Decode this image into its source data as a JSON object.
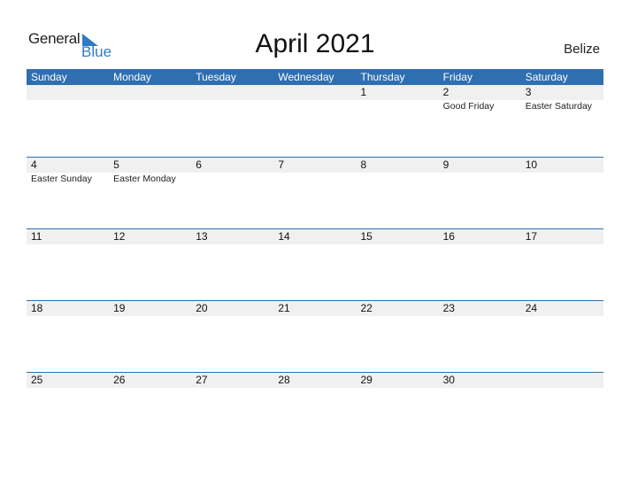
{
  "logo": {
    "word1": "General",
    "word2": "Blue"
  },
  "title": "April 2021",
  "country": "Belize",
  "colors": {
    "header_bg": "#2e6fb0",
    "band_bg": "#f0f0f0",
    "logo_blue": "#2f7bc4"
  },
  "weekdays": [
    "Sunday",
    "Monday",
    "Tuesday",
    "Wednesday",
    "Thursday",
    "Friday",
    "Saturday"
  ],
  "weeks": [
    {
      "days": [
        "",
        "",
        "",
        "",
        "1",
        "2",
        "3"
      ],
      "events": [
        "",
        "",
        "",
        "",
        "",
        "Good Friday",
        "Easter Saturday"
      ]
    },
    {
      "days": [
        "4",
        "5",
        "6",
        "7",
        "8",
        "9",
        "10"
      ],
      "events": [
        "Easter Sunday",
        "Easter Monday",
        "",
        "",
        "",
        "",
        ""
      ]
    },
    {
      "days": [
        "11",
        "12",
        "13",
        "14",
        "15",
        "16",
        "17"
      ],
      "events": [
        "",
        "",
        "",
        "",
        "",
        "",
        ""
      ]
    },
    {
      "days": [
        "18",
        "19",
        "20",
        "21",
        "22",
        "23",
        "24"
      ],
      "events": [
        "",
        "",
        "",
        "",
        "",
        "",
        ""
      ]
    },
    {
      "days": [
        "25",
        "26",
        "27",
        "28",
        "29",
        "30",
        ""
      ],
      "events": [
        "",
        "",
        "",
        "",
        "",
        "",
        ""
      ]
    }
  ]
}
